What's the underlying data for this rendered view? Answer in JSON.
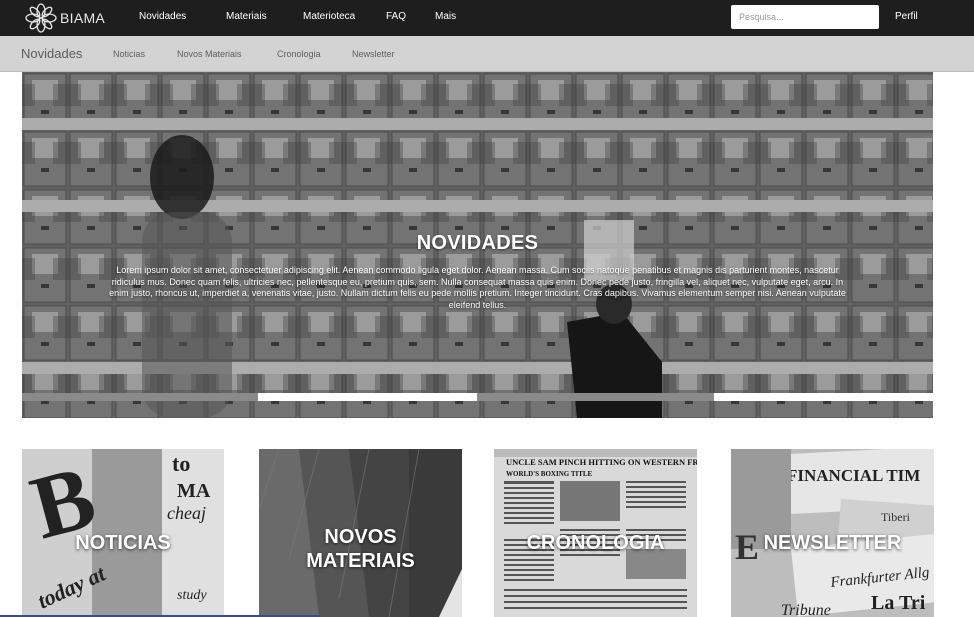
{
  "brand": {
    "name": "BIAMA"
  },
  "topnav": {
    "links": [
      "Novidades",
      "Materiais",
      "Materioteca",
      "FAQ",
      "Mais"
    ],
    "search_placeholder": "Pesquisa...",
    "profile": "Perfil"
  },
  "subnav": {
    "title": "Novidades",
    "links": [
      "Noticias",
      "Novos Materiais",
      "Cronologia",
      "Newsletter"
    ]
  },
  "hero": {
    "title": "NOVIDADES",
    "text": "Lorem ipsum dolor sit amet, consectetuer adipiscing elit. Aenean commodo ligula eget dolor. Aenean massa. Cum sociis natoque penatibus et magnis dis parturient montes, nascetur ridiculus mus. Donec quam felis, ultricies nec, pellentesque eu, pretium quis, sem. Nulla consequat massa quis enim. Donec pede justo, fringilla vel, aliquet nec, vulputate eget, arcu. In enim justo, rhoncus ut, imperdiet a, venenatis vitae, justo. Nullam dictum felis eu pede mollis pretium. Integer tincidunt. Cras dapibus. Vivamus elementum semper nisi. Aenean vulputate eleifend tellus.",
    "slides": 4,
    "active_slides": [
      2,
      4
    ]
  },
  "cards": [
    {
      "label_line1": "NOTICIAS",
      "label_line2": ""
    },
    {
      "label_line1": "NOVOS",
      "label_line2": "MATERIAIS"
    },
    {
      "label_line1": "CRONOLOGIA",
      "label_line2": ""
    },
    {
      "label_line1": "NEWSLETTER",
      "label_line2": ""
    }
  ],
  "card_art_text": {
    "noticias": [
      "to",
      "MA",
      "cheaj",
      "today at",
      "study"
    ],
    "cronologia": [
      "UNCLE SAM PINCH HITTING ON WESTERN FRONT",
      "WORLD'S BOXING TITLE"
    ],
    "newsletter": [
      "FINANCIAL TIM",
      "Frankfurter Allg",
      "La Tri",
      "Tribune",
      "Tiberi"
    ]
  },
  "colors": {
    "topbar": "#1e1e1e",
    "subbar": "#d3d3d3",
    "indicator_active": "#ffffff",
    "indicator_inactive": "#8a8a8a"
  }
}
